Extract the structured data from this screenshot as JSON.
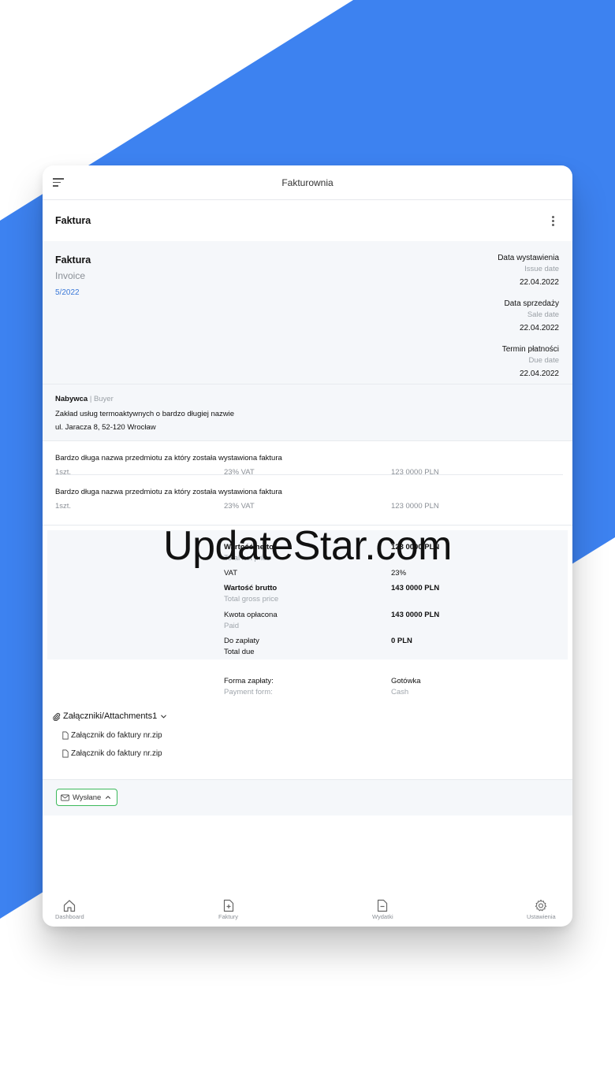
{
  "brand": {
    "accent": "#3d82f0",
    "link": "#3b79d8",
    "success": "#3cb95b"
  },
  "topbar": {
    "title": "Fakturownia",
    "menu_icon": "hamburger-menu-icon"
  },
  "page": {
    "title": "Faktura",
    "more_icon": "kebab-vertical-icon"
  },
  "invoice": {
    "title": "Faktura",
    "subtitle": "Invoice",
    "number": "5/2022",
    "dates": [
      {
        "label": "Data wystawienia",
        "sub": "Issue date",
        "value": "22.04.2022"
      },
      {
        "label": "Data sprzedaży",
        "sub": "Sale date",
        "value": "22.04.2022"
      },
      {
        "label": "Termin płatności",
        "sub": "Due date",
        "value": "22.04.2022"
      }
    ]
  },
  "buyer": {
    "label": "Nabywca",
    "label_en": "Buyer",
    "separator": " | ",
    "name": "Zakład usług termoaktywnych o bardzo długiej nazwie",
    "address": "ul. Jaracza 8, 52-120 Wrocław"
  },
  "items": [
    {
      "name": "Bardzo długa nazwa przedmiotu za który została wystawiona faktura",
      "qty": "1szt.",
      "vat": "23% VAT",
      "price": "123 0000 PLN"
    },
    {
      "name": "Bardzo długa nazwa przedmiotu za który została wystawiona faktura",
      "qty": "1szt.",
      "vat": "23% VAT",
      "price": "123 0000 PLN"
    }
  ],
  "summary": {
    "net": {
      "label": "Wartość netto",
      "sub": "Total net price",
      "value": "123 0000 PLN"
    },
    "vat": {
      "label": "VAT",
      "value": "23%"
    },
    "gross": {
      "label": "Wartość brutto",
      "sub": "Total gross price",
      "value": "143 0000 PLN"
    },
    "paid": {
      "label": "Kwota opłacona",
      "sub": "Paid",
      "value": "143 0000 PLN"
    },
    "due": {
      "label": "Do zapłaty",
      "sub": "Total due",
      "value": "0 PLN"
    }
  },
  "payment": {
    "label": "Forma zapłaty:",
    "sub": "Payment form:",
    "value": "Gotówka",
    "value_sub": "Cash"
  },
  "attachments": {
    "header": "Załączniki/Attachments1",
    "files": [
      "Załącznik do faktury nr.zip",
      "Załącznik do faktury nr.zip"
    ]
  },
  "status": {
    "label": "Wysłane"
  },
  "bottom_nav": [
    {
      "label": "Dashboard",
      "icon": "home-icon"
    },
    {
      "label": "Faktury",
      "icon": "document-plus-icon"
    },
    {
      "label": "Wydatki",
      "icon": "document-minus-icon"
    },
    {
      "label": "Ustawienia",
      "icon": "gear-icon"
    }
  ],
  "watermark": "UpdateStar.com"
}
